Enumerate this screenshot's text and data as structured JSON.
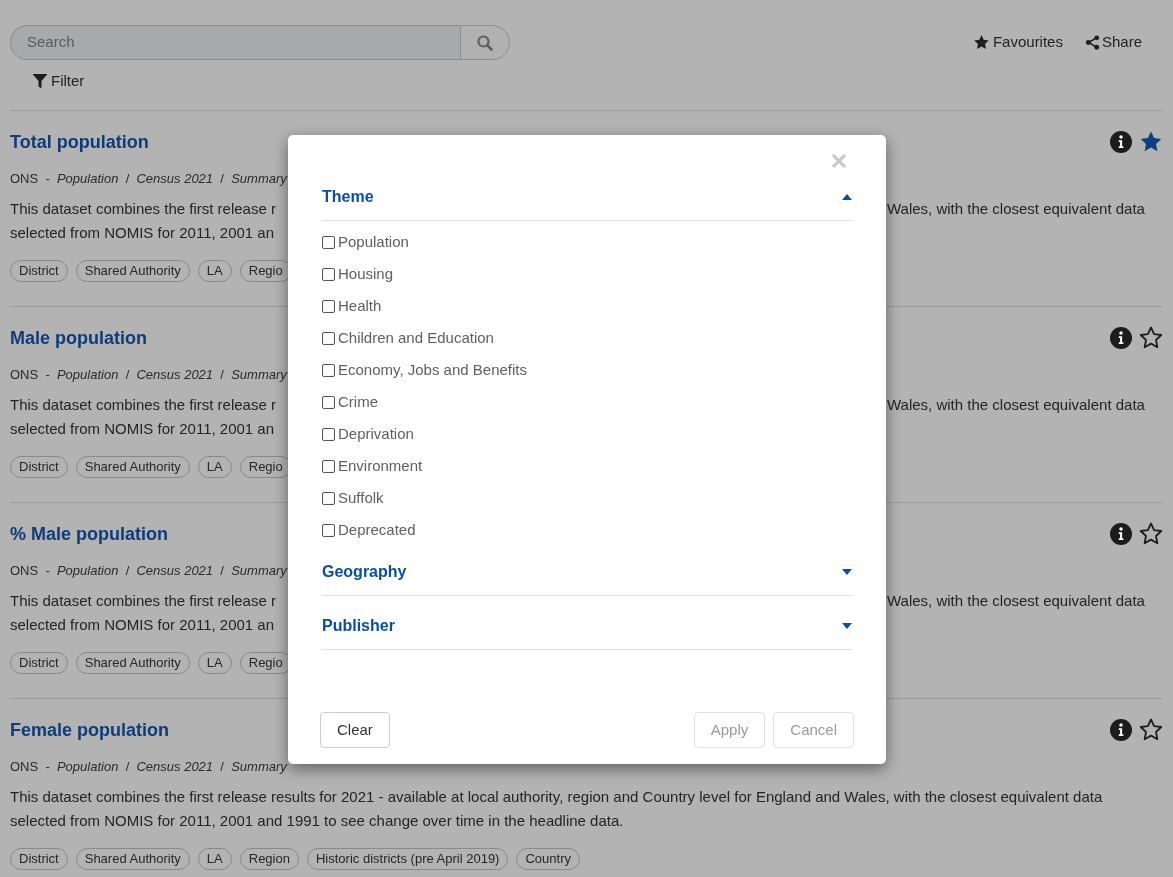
{
  "toolbar": {
    "search": {
      "placeholder": "Search"
    },
    "filter": {
      "label": "Filter"
    },
    "favourites": {
      "label": "Favourites"
    },
    "share": {
      "label": "Share"
    }
  },
  "datasets": [
    {
      "title": "Total population",
      "favourite": true,
      "meta": "ONS  -  *Population*  /  *Census 2021*  /  *Summary*",
      "description_left": [
        "This dataset combines the first release r",
        "selected from NOMIS for 2011, 2001 an"
      ],
      "description_right": "Wales, with the closest equivalent data",
      "tags": [
        "District",
        "Shared Authority",
        "LA",
        "Regio"
      ]
    },
    {
      "title": "Male population",
      "favourite": false,
      "meta": "ONS  -  *Population*  /  *Census 2021*  /  *Summary*",
      "description_left": [
        "This dataset combines the first release r",
        "selected from NOMIS for 2011, 2001 an"
      ],
      "description_right": "Wales, with the closest equivalent data",
      "tags": [
        "District",
        "Shared Authority",
        "LA",
        "Regio"
      ]
    },
    {
      "title": "% Male population",
      "favourite": false,
      "meta": "ONS  -  *Population*  /  *Census 2021*  /  *Summary*",
      "description_left": [
        "This dataset combines the first release r",
        "selected from NOMIS for 2011, 2001 an"
      ],
      "description_right": "Wales, with the closest equivalent data",
      "tags": [
        "District",
        "Shared Authority",
        "LA",
        "Regio"
      ]
    },
    {
      "title": "Female population",
      "favourite": false,
      "meta": "ONS  -  *Population*  /  *Census 2021*  /  *Summary*",
      "description": "This dataset combines the first release results for 2021 - available at local authority, region and Country level for England and Wales, with the closest equivalent data selected from NOMIS for 2011, 2001 and 1991 to see change over time in the headline data.",
      "tags": [
        "District",
        "Shared Authority",
        "LA",
        "Region",
        "Historic districts (pre April 2019)",
        "Country"
      ]
    }
  ],
  "filter_dialog": {
    "sections": [
      {
        "title": "Theme",
        "expanded": true,
        "options": [
          {
            "label": "Population",
            "checked": false
          },
          {
            "label": "Housing",
            "checked": false
          },
          {
            "label": "Health",
            "checked": false
          },
          {
            "label": "Children and Education",
            "checked": false
          },
          {
            "label": "Economy, Jobs and Benefits",
            "checked": false
          },
          {
            "label": "Crime",
            "checked": false
          },
          {
            "label": "Deprivation",
            "checked": false
          },
          {
            "label": "Environment",
            "checked": false
          },
          {
            "label": "Suffolk",
            "checked": false
          },
          {
            "label": "Deprecated",
            "checked": false
          }
        ]
      },
      {
        "title": "Geography",
        "expanded": false
      },
      {
        "title": "Publisher",
        "expanded": false
      }
    ],
    "footer": {
      "left_buttons": [
        {
          "label": "Clear",
          "disabled": false
        }
      ],
      "right_buttons": [
        {
          "label": "Apply",
          "disabled": true
        },
        {
          "label": "Cancel",
          "disabled": true
        }
      ]
    }
  }
}
